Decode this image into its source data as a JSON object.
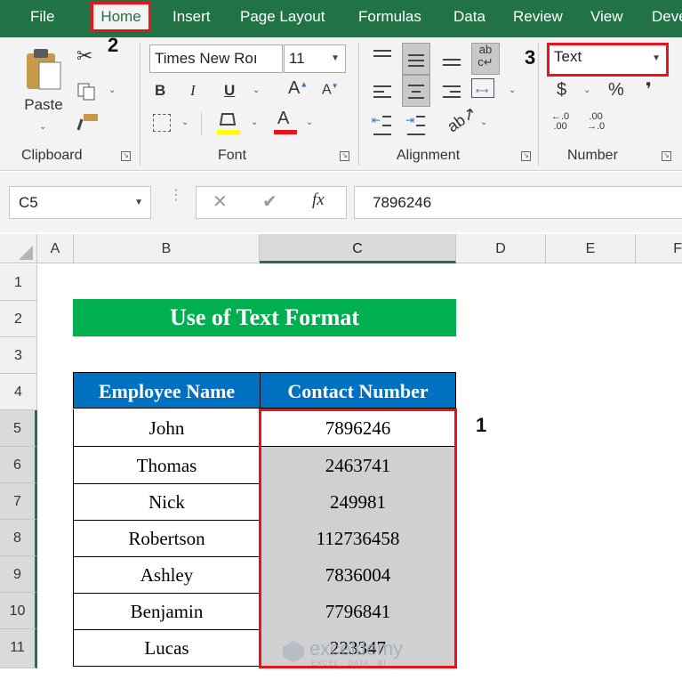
{
  "menu": {
    "items": [
      "File",
      "Home",
      "Insert",
      "Page Layout",
      "Formulas",
      "Data",
      "Review",
      "View",
      "Deve"
    ]
  },
  "ribbon": {
    "clipboard": {
      "paste_label": "Paste",
      "group_label": "Clipboard"
    },
    "font": {
      "font_name": "Times New Roı",
      "font_size": "11",
      "group_label": "Font",
      "bold": "B",
      "italic": "I",
      "underline": "U"
    },
    "alignment": {
      "group_label": "Alignment"
    },
    "number": {
      "format_value": "Text",
      "group_label": "Number",
      "currency": "$",
      "percent": "%",
      "comma": "❜"
    }
  },
  "callouts": {
    "one": "1",
    "two": "2",
    "three": "3"
  },
  "formula_bar": {
    "name_box": "C5",
    "value": "7896246",
    "fx": "fx"
  },
  "columns": [
    "A",
    "B",
    "C",
    "D",
    "E",
    "F"
  ],
  "rows": [
    "1",
    "2",
    "3",
    "4",
    "5",
    "6",
    "7",
    "8",
    "9",
    "10",
    "11"
  ],
  "sheet": {
    "title": "Use of Text Format",
    "headers": [
      "Employee Name",
      "Contact Number"
    ],
    "records": [
      {
        "name": "John",
        "contact": "7896246"
      },
      {
        "name": "Thomas",
        "contact": "2463741"
      },
      {
        "name": "Nick",
        "contact": "249981"
      },
      {
        "name": "Robertson",
        "contact": "112736458"
      },
      {
        "name": "Ashley",
        "contact": "7836004"
      },
      {
        "name": "Benjamin",
        "contact": "7796841"
      },
      {
        "name": "Lucas",
        "contact": "223347"
      }
    ]
  },
  "watermark": {
    "text": "exceldemy",
    "sub": "EXCEL · DATA · BI"
  },
  "colors": {
    "excel_green": "#217346",
    "title_green": "#00b050",
    "header_blue": "#0070c0",
    "highlight_red": "#e8141c"
  }
}
